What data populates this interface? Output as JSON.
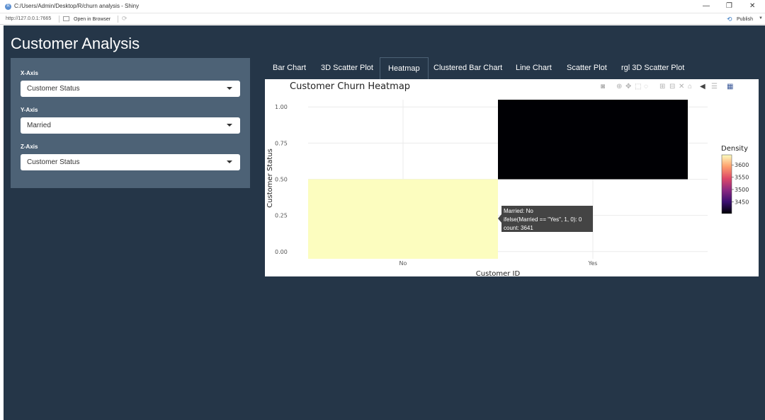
{
  "window": {
    "title": "C:/Users/Admin/Desktop/R/churn analysis - Shiny",
    "minimize": "—",
    "restore": "❐",
    "close": "✕"
  },
  "addressbar": {
    "url": "http://127.0.0.1:7665",
    "open_in_browser": "Open in Browser",
    "publish": "Publish"
  },
  "app": {
    "title": "Customer Analysis"
  },
  "sidebar": {
    "x_axis_label": "X-Axis",
    "x_axis_value": "Customer Status",
    "y_axis_label": "Y-Axis",
    "y_axis_value": "Married",
    "z_axis_label": "Z-Axis",
    "z_axis_value": "Customer Status"
  },
  "tabs": [
    {
      "label": "Bar Chart"
    },
    {
      "label": "3D Scatter Plot"
    },
    {
      "label": "Heatmap"
    },
    {
      "label": "Clustered Bar Chart"
    },
    {
      "label": "Line Chart"
    },
    {
      "label": "Scatter Plot"
    },
    {
      "label": "rgl 3D Scatter Plot"
    }
  ],
  "active_tab": "Heatmap",
  "colors": {
    "app_bg": "#253648",
    "sidebar_bg": "#4d6276",
    "cell_high": "#000004",
    "cell_low": "#fcfdbf"
  },
  "chart_data": {
    "type": "heatmap",
    "title": "Customer Churn Heatmap",
    "xlabel": "Customer ID",
    "ylabel": "Customer Status",
    "categories": [
      "No",
      "Yes"
    ],
    "yticks": [
      "0.00",
      "0.25",
      "0.50",
      "0.75",
      "1.00"
    ],
    "ylim": [
      -0.05,
      1.05
    ],
    "cells": [
      {
        "x": "No",
        "y0": -0.05,
        "y1": 0.5,
        "count": 3641
      },
      {
        "x": "Yes",
        "y0": 0.5,
        "y1": 1.05,
        "count": 3402
      }
    ],
    "colorbar": {
      "title": "Density",
      "ticks": [
        "3600",
        "3550",
        "3500",
        "3450"
      ],
      "range": [
        3402,
        3641
      ],
      "colorscale": [
        "#000004",
        "#3b0f70",
        "#8c2981",
        "#de4968",
        "#fe9f6d",
        "#fcfdbf"
      ]
    },
    "tooltip": {
      "line1": "Married: No",
      "line2": "ifelse(Married == \"Yes\", 1, 0): 0",
      "line3": "count: 3641"
    },
    "grid": true,
    "legend_position": "right"
  }
}
